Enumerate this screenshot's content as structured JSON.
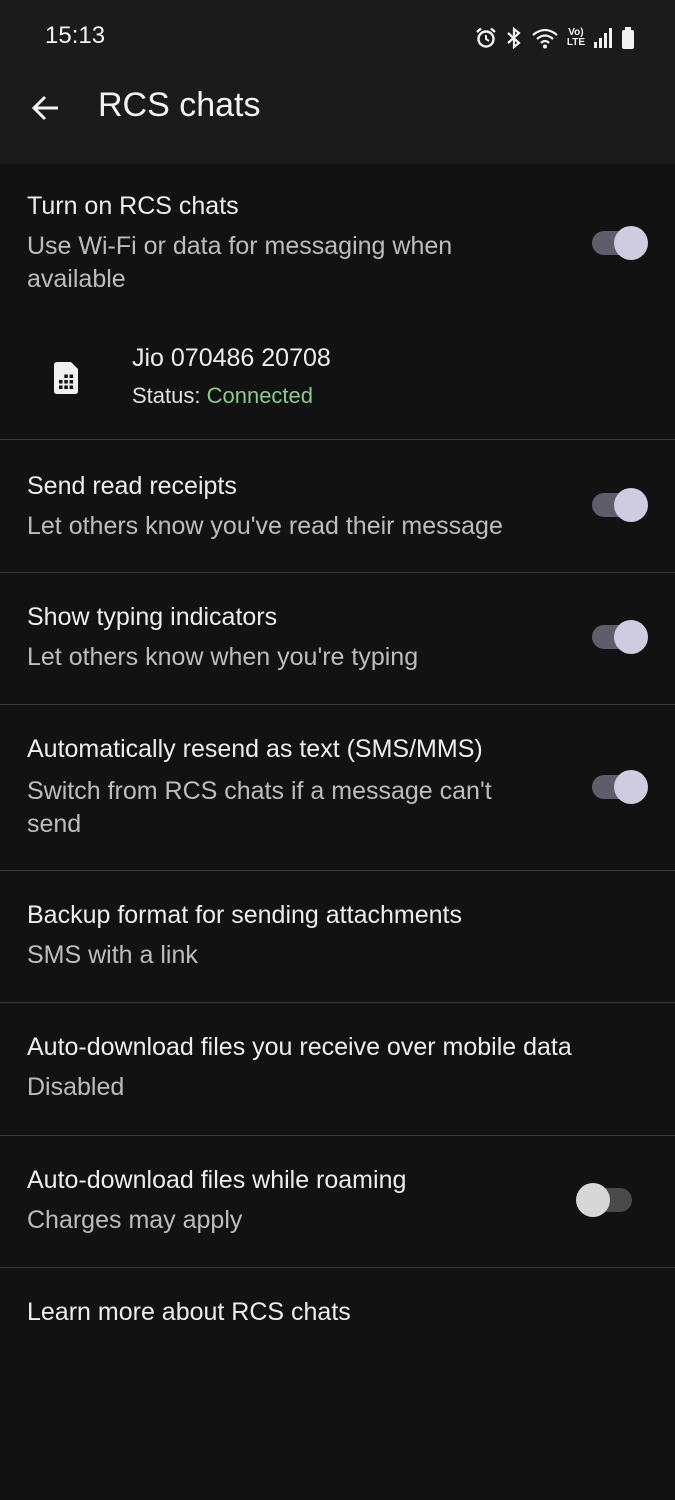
{
  "status_bar": {
    "time": "15:13",
    "icons": [
      "alarm-icon",
      "bluetooth-icon",
      "wifi-icon",
      "volte-icon",
      "signal-icon",
      "battery-icon"
    ],
    "volte_text_top": "Vo)",
    "volte_text_bottom": "LTE"
  },
  "app_bar": {
    "title": "RCS chats",
    "back_icon": "arrow-left-icon"
  },
  "settings": {
    "rcs": {
      "title": "Turn on RCS chats",
      "subtitle": "Use Wi-Fi or data for messaging when available",
      "enabled": true
    },
    "sim": {
      "icon": "sim-card-icon",
      "name": "Jio 070486 20708",
      "status_label": "Status: ",
      "status_value": "Connected",
      "status_color": "#8bc98f"
    },
    "read_receipts": {
      "title": "Send read receipts",
      "subtitle": "Let others know you've read their message",
      "enabled": true
    },
    "typing": {
      "title": "Show typing indicators",
      "subtitle": "Let others know when you're typing",
      "enabled": true
    },
    "resend": {
      "title": "Automatically resend as text (SMS/MMS)",
      "subtitle": "Switch from RCS chats if a message can't send",
      "enabled": true
    },
    "backup_format": {
      "title": "Backup format for sending attachments",
      "value": "SMS with a link"
    },
    "auto_download_mobile": {
      "title": "Auto-download files you receive over mobile data",
      "value": "Disabled"
    },
    "auto_download_roaming": {
      "title": "Auto-download files while roaming",
      "subtitle": "Charges may apply",
      "enabled": false
    },
    "learn_more": {
      "label": "Learn more about RCS chats"
    }
  },
  "colors": {
    "background": "#121212",
    "bar": "#1b1b1b",
    "toggle_on_track": "#5f5d6a",
    "toggle_on_knob": "#cfcbe0",
    "toggle_off_track": "#4a4a4a",
    "toggle_off_knob": "#d7d7d7"
  }
}
